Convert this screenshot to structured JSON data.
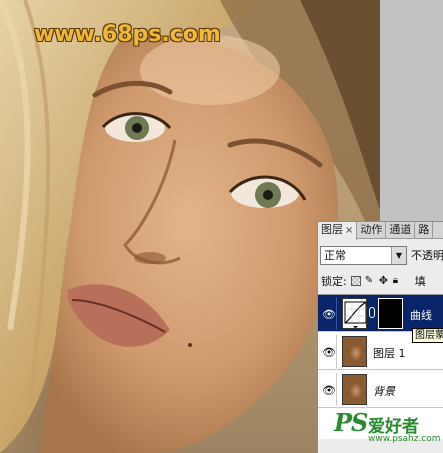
{
  "watermark": {
    "text": "www.68ps.com"
  },
  "layers_panel": {
    "tabs": [
      {
        "label": "图层",
        "close": "×"
      },
      {
        "label": "动作"
      },
      {
        "label": "通道"
      },
      {
        "label": "路"
      }
    ],
    "blend_mode": "正常",
    "opacity_label": "不透明",
    "lock_label": "锁定:",
    "fill_label": "填",
    "layers": [
      {
        "name": "曲线",
        "type": "adjustment",
        "selected": true
      },
      {
        "name": "图层 1",
        "type": "pixel"
      },
      {
        "name": "背景",
        "type": "background"
      }
    ],
    "tooltip": "图层蒙"
  },
  "logo": {
    "mark": "PS",
    "text": "爱好者",
    "url": "www.psahz.com"
  },
  "colors": {
    "selection": "#0a246a",
    "logo_green": "#2a8a30",
    "watermark_gold": "#f0b83a"
  }
}
